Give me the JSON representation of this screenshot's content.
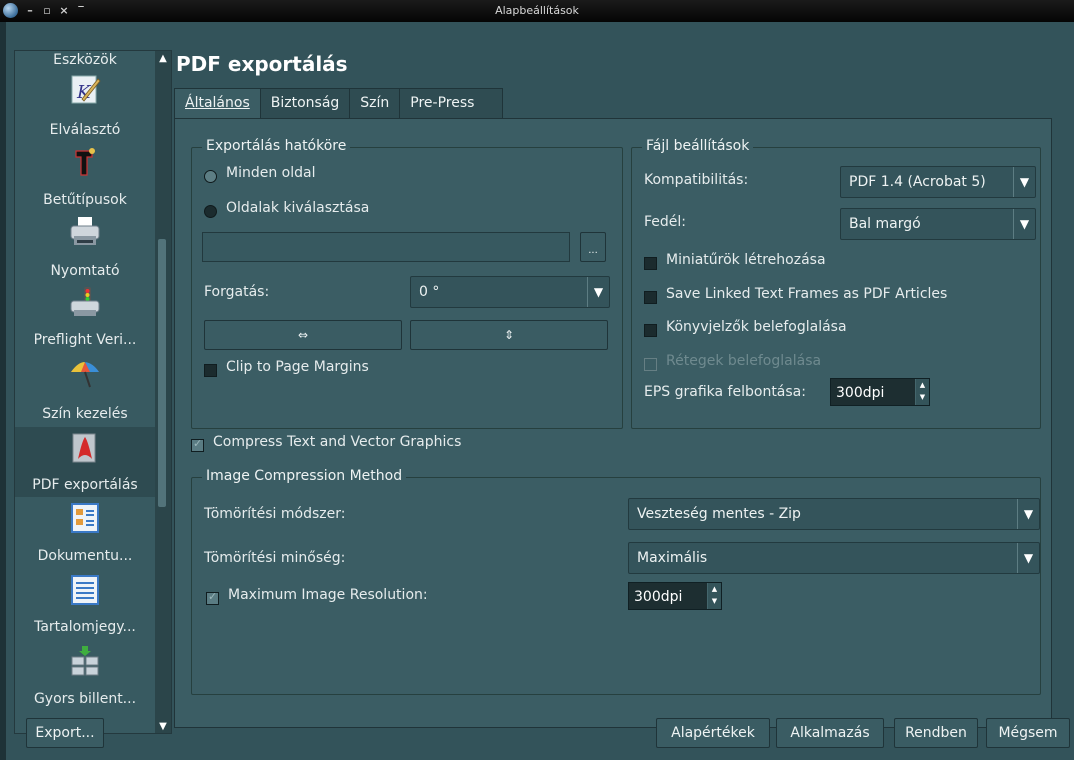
{
  "window": {
    "title": "Alapbeállítások"
  },
  "sidebar": {
    "items": [
      {
        "label": "Eszközök"
      },
      {
        "label": "Elválasztó"
      },
      {
        "label": "Betűtípusok"
      },
      {
        "label": "Nyomtató"
      },
      {
        "label": "Preflight Veri..."
      },
      {
        "label": "Szín kezelés"
      },
      {
        "label": "PDF exportálás"
      },
      {
        "label": "Dokumentu..."
      },
      {
        "label": "Tartalomjegy..."
      },
      {
        "label": "Gyors billent..."
      }
    ],
    "selected": "PDF exportálás"
  },
  "page": {
    "title": "PDF exportálás"
  },
  "tabs": [
    {
      "label": "Általános",
      "active": true
    },
    {
      "label": "Biztonság"
    },
    {
      "label": "Szín"
    },
    {
      "label": "Pre-Press"
    }
  ],
  "export_scope": {
    "title": "Exportálás hatóköre",
    "all_pages": "Minden oldal",
    "choose_pages": "Oldalak kiválasztása",
    "page_input": "",
    "browse_label": "...",
    "rotation_label": "Forgatás:",
    "rotation_value": "0 °",
    "clip_label": "Clip to Page Margins"
  },
  "file_settings": {
    "title": "Fájl beállítások",
    "compat_label": "Kompatibilitás:",
    "compat_value": "PDF 1.4 (Acrobat 5)",
    "cover_label": "Fedél:",
    "cover_value": "Bal margó",
    "thumbnails": "Miniatűrök létrehozása",
    "linked_frames": "Save Linked Text Frames as PDF Articles",
    "bookmarks": "Könyvjelzők belefoglalása",
    "layers": "Rétegek belefoglalása",
    "eps_label": "EPS grafika felbontása:",
    "eps_value": "300dpi"
  },
  "compress_text": "Compress Text and Vector Graphics",
  "image_compression": {
    "title": "Image Compression Method",
    "method_label": "Tömörítési módszer:",
    "method_value": "Veszteség mentes - Zip",
    "quality_label": "Tömörítési minőség:",
    "quality_value": "Maximális",
    "max_res_label": "Maximum Image Resolution:",
    "max_res_value": "300dpi"
  },
  "footer": {
    "export": "Export...",
    "defaults": "Alapértékek",
    "apply": "Alkalmazás",
    "ok": "Rendben",
    "cancel": "Mégsem"
  }
}
